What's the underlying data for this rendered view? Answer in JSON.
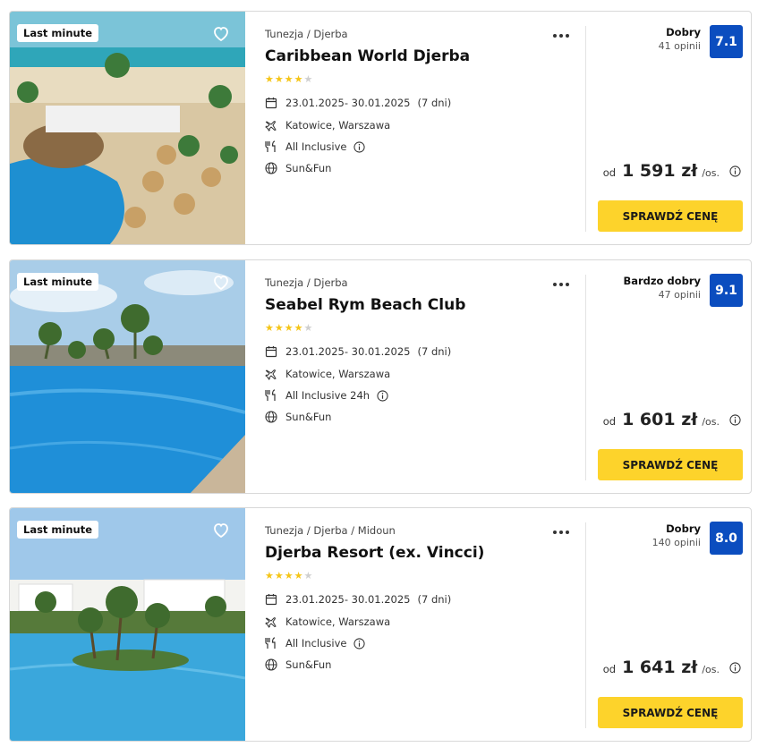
{
  "offers": [
    {
      "badge": "Last minute",
      "destination": "Tunezja / Djerba",
      "name": "Caribbean World Djerba",
      "stars_filled": 4,
      "stars_total": 5,
      "dates": "23.01.2025- 30.01.2025",
      "duration": "(7 dni)",
      "departure": "Katowice, Warszawa",
      "board": "All Inclusive",
      "concept": "Sun&Fun",
      "rating_label": "Dobry",
      "reviews": "41 opinii",
      "score": "7.1",
      "price_prefix": "od",
      "price": "1 591 zł",
      "price_suffix": "/os.",
      "cta": "SPRAWDŹ CENĘ"
    },
    {
      "badge": "Last minute",
      "destination": "Tunezja / Djerba",
      "name": "Seabel Rym Beach Club",
      "stars_filled": 4,
      "stars_total": 5,
      "dates": "23.01.2025- 30.01.2025",
      "duration": "(7 dni)",
      "departure": "Katowice, Warszawa",
      "board": "All Inclusive 24h",
      "concept": "Sun&Fun",
      "rating_label": "Bardzo dobry",
      "reviews": "47 opinii",
      "score": "9.1",
      "price_prefix": "od",
      "price": "1 601 zł",
      "price_suffix": "/os.",
      "cta": "SPRAWDŹ CENĘ"
    },
    {
      "badge": "Last minute",
      "destination": "Tunezja / Djerba / Midoun",
      "name": "Djerba Resort (ex. Vincci)",
      "stars_filled": 4,
      "stars_total": 5,
      "dates": "23.01.2025- 30.01.2025",
      "duration": "(7 dni)",
      "departure": "Katowice, Warszawa",
      "board": "All Inclusive",
      "concept": "Sun&Fun",
      "rating_label": "Dobry",
      "reviews": "140 opinii",
      "score": "8.0",
      "price_prefix": "od",
      "price": "1 641 zł",
      "price_suffix": "/os.",
      "cta": "SPRAWDŹ CENĘ"
    }
  ],
  "icons": {
    "favorite": "heart-icon",
    "more": "more-dots-icon",
    "dates": "calendar-icon",
    "departure": "plane-icon",
    "board": "cutlery-icon",
    "concept": "globe-icon",
    "info": "info-icon"
  },
  "colors": {
    "score_bg": "#0b4dbf",
    "cta_bg": "#fdd32b",
    "star": "#f5c518"
  }
}
